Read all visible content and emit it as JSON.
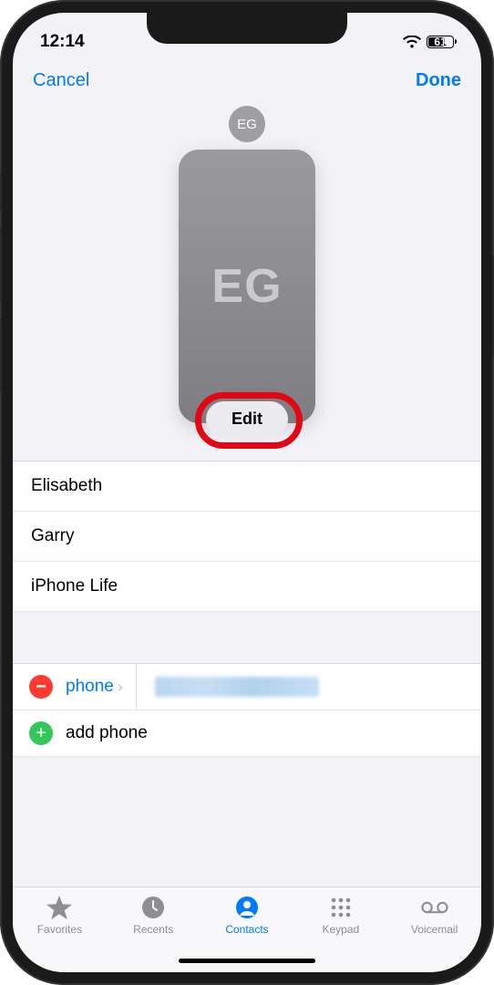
{
  "status": {
    "time": "12:14",
    "battery_pct": "61"
  },
  "nav": {
    "cancel": "Cancel",
    "done": "Done"
  },
  "poster": {
    "mini_initials": "EG",
    "card_initials": "EG",
    "edit_label": "Edit"
  },
  "fields": {
    "first_name": "Elisabeth",
    "last_name": "Garry",
    "company": "iPhone Life"
  },
  "phone": {
    "label": "phone",
    "add_label": "add phone"
  },
  "tabs": {
    "favorites": "Favorites",
    "recents": "Recents",
    "contacts": "Contacts",
    "keypad": "Keypad",
    "voicemail": "Voicemail"
  }
}
